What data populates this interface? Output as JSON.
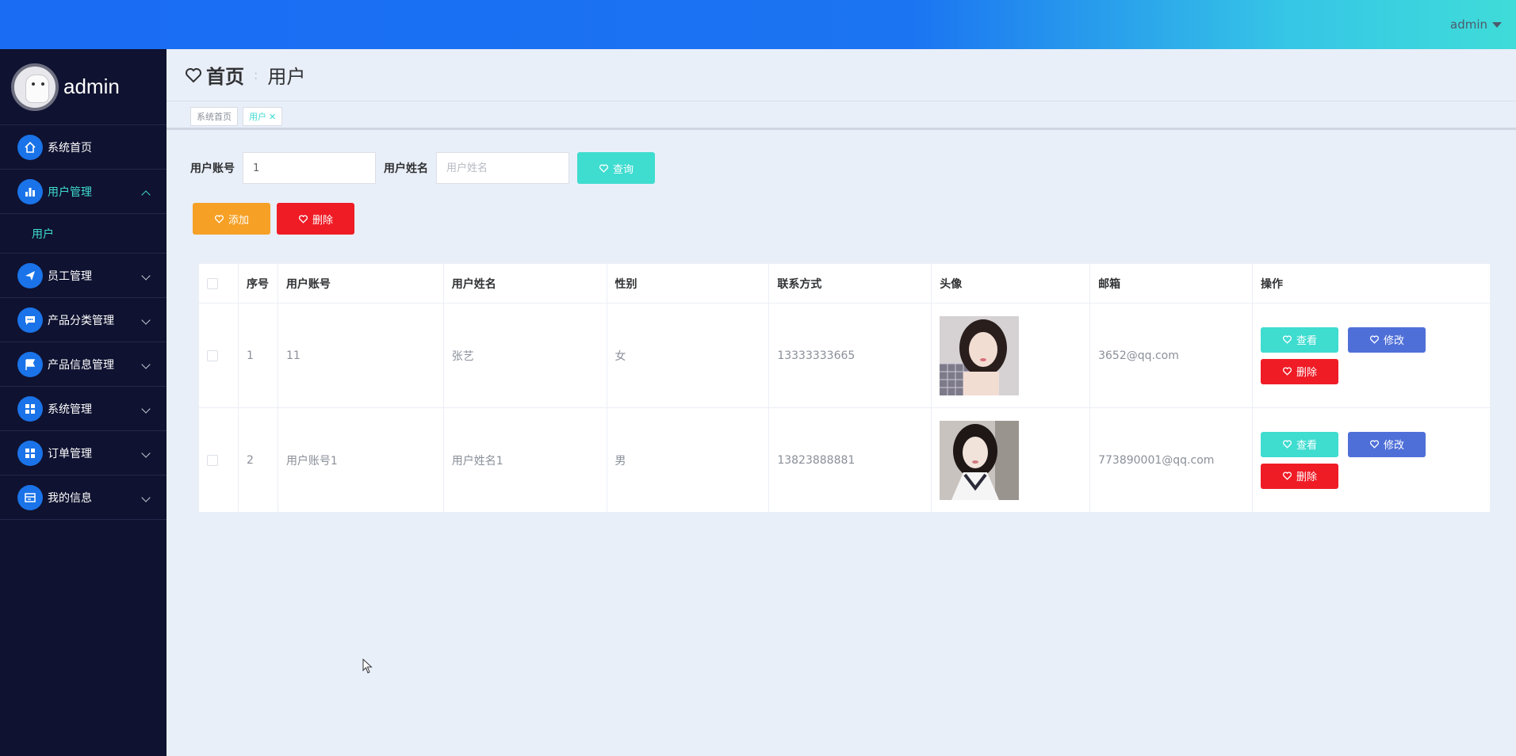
{
  "topbar": {
    "user": "admin"
  },
  "sidebar": {
    "profile_name": "admin",
    "items": [
      {
        "label": "系统首页",
        "icon": "home-icon"
      },
      {
        "label": "用户管理",
        "icon": "bar-chart-icon",
        "expanded": true,
        "sub": [
          "用户"
        ]
      },
      {
        "label": "员工管理",
        "icon": "paper-plane-icon"
      },
      {
        "label": "产品分类管理",
        "icon": "chat-icon"
      },
      {
        "label": "产品信息管理",
        "icon": "flag-icon"
      },
      {
        "label": "系统管理",
        "icon": "grid-icon"
      },
      {
        "label": "订单管理",
        "icon": "grid-icon"
      },
      {
        "label": "我的信息",
        "icon": "card-icon"
      }
    ]
  },
  "breadcrumb": {
    "home": "首页",
    "sep": ":",
    "current": "用户"
  },
  "tags": [
    {
      "label": "系统首页"
    },
    {
      "label": "用户"
    }
  ],
  "search": {
    "account_label": "用户账号",
    "account_value": "1",
    "name_label": "用户姓名",
    "name_placeholder": "用户姓名",
    "query_button": "查询"
  },
  "toolbar": {
    "add": "添加",
    "delete": "删除"
  },
  "table": {
    "headers": [
      "序号",
      "用户账号",
      "用户姓名",
      "性别",
      "联系方式",
      "头像",
      "邮箱",
      "操作"
    ],
    "rows": [
      {
        "index": "1",
        "account": "11",
        "name": "张艺",
        "gender": "女",
        "phone": "13333333665",
        "email": "3652@qq.com"
      },
      {
        "index": "2",
        "account": "用户账号1",
        "name": "用户姓名1",
        "gender": "男",
        "phone": "13823888881",
        "email": "773890001@qq.com"
      }
    ],
    "op_view": "查看",
    "op_edit": "修改",
    "op_delete": "删除"
  },
  "colors": {
    "teal": "#3fdcd0",
    "orange": "#f6a025",
    "red": "#ef1c26",
    "blue": "#4f6fd8",
    "sidebar": "#0f1230"
  }
}
